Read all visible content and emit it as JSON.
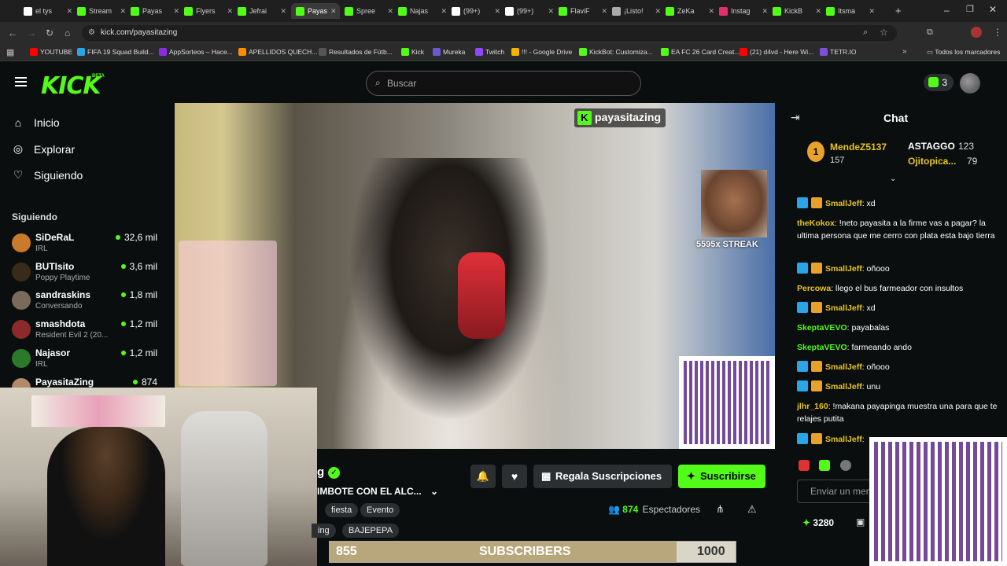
{
  "browser": {
    "tabs": [
      {
        "label": "el tys",
        "color": "#ffffff"
      },
      {
        "label": "Stream",
        "color": "#53fc18"
      },
      {
        "label": "Payas",
        "color": "#53fc18"
      },
      {
        "label": "Flyers",
        "color": "#53fc18"
      },
      {
        "label": "Jefrai",
        "color": "#53fc18"
      },
      {
        "label": "Payas",
        "color": "#53fc18"
      },
      {
        "label": "Spree",
        "color": "#53fc18"
      },
      {
        "label": "Najas",
        "color": "#53fc18"
      },
      {
        "label": "(99+)",
        "color": "#ffffff"
      },
      {
        "label": "(99+)",
        "color": "#ffffff"
      },
      {
        "label": "FlaviF",
        "color": "#53fc18"
      },
      {
        "label": "¡Listo!",
        "color": "#aaaaaa"
      },
      {
        "label": "ZeKa",
        "color": "#53fc18"
      },
      {
        "label": "Instag",
        "color": "#e1306c"
      },
      {
        "label": "KickB",
        "color": "#53fc18"
      },
      {
        "label": "Itsma",
        "color": "#53fc18"
      }
    ],
    "url": "kick.com/payasitazing",
    "bookmarks": [
      {
        "label": "YOUTUBE",
        "color": "#ff0000"
      },
      {
        "label": "FIFA 19 Squad Build...",
        "color": "#2aa6e8"
      },
      {
        "label": "AppSorteos – Hace...",
        "color": "#8a2be2"
      },
      {
        "label": "APELLIDOS QUECH...",
        "color": "#ff8c00"
      },
      {
        "label": "Resultados de Fútb...",
        "color": "#555555"
      },
      {
        "label": "Kick",
        "color": "#53fc18"
      },
      {
        "label": "Mureka",
        "color": "#6a5acd"
      },
      {
        "label": "Twitch",
        "color": "#9146ff"
      },
      {
        "label": "!!! - Google Drive",
        "color": "#f4b400"
      },
      {
        "label": "KickBot: Customiza...",
        "color": "#53fc18"
      },
      {
        "label": "EA FC 26 Card Creat...",
        "color": "#53fc18"
      },
      {
        "label": "(21) d4vd - Here Wi...",
        "color": "#ff0000"
      },
      {
        "label": "TETR.IO",
        "color": "#7b4fd6"
      }
    ],
    "all_bookmarks": "Todos los marcadores"
  },
  "kick": {
    "logo": "KICK",
    "beta": "BETA",
    "search_placeholder": "Buscar",
    "notif_count": "3"
  },
  "sidebar": {
    "nav": [
      {
        "label": "Inicio",
        "icon": "home-icon"
      },
      {
        "label": "Explorar",
        "icon": "compass-icon"
      },
      {
        "label": "Siguiendo",
        "icon": "heart-icon"
      }
    ],
    "following_title": "Siguiendo",
    "following": [
      {
        "name": "SiDeRaL",
        "category": "IRL",
        "viewers": "32,6 mil",
        "color": "#c97a2a"
      },
      {
        "name": "BUTIsito",
        "category": "Poppy Playtime",
        "viewers": "3,6 mil",
        "color": "#3a2a1a"
      },
      {
        "name": "sandraskins",
        "category": "Conversando",
        "viewers": "1,8 mil",
        "color": "#7a6a5a"
      },
      {
        "name": "smashdota",
        "category": "Resident Evil 2 (20...",
        "viewers": "1,2 mil",
        "color": "#8a2a2a"
      },
      {
        "name": "Najasor",
        "category": "IRL",
        "viewers": "1,2 mil",
        "color": "#2a7a2a"
      },
      {
        "name": "PayasitaZing",
        "category": "",
        "viewers": "874",
        "color": "#b08a6a"
      }
    ]
  },
  "video": {
    "watermark": "payasitazing",
    "streak": "5595x STREAK"
  },
  "stream_info": {
    "title": "IMBOTE CON EL ALC...",
    "tags": [
      "fiesta",
      "Evento",
      "BAJEPEPA"
    ],
    "tag_partial": "ing",
    "name_partial": "g",
    "viewers": "874",
    "viewers_label": "Espectadores",
    "gift_label": "Regala Suscripciones",
    "subscribe_label": "Suscribirse"
  },
  "sub_goal": {
    "current": "855",
    "label": "SUBSCRIBERS",
    "target": "1000",
    "progress": 0.855
  },
  "chat": {
    "title": "Chat",
    "top": [
      {
        "name": "MendeZ5137",
        "count": "157"
      },
      {
        "name": "ASTAGGO",
        "count": "123"
      },
      {
        "name": "Ojitopica...",
        "count": "79"
      }
    ],
    "messages": [
      {
        "user": "SmallJeff",
        "badges": true,
        "text": "xd",
        "color": "#e8c51c"
      },
      {
        "user": "theKokox",
        "badges": false,
        "text": "!neto payasita a la firme vas a pagar? la ultima persona que me cerro con plata esta bajo tierra",
        "color": "#e8c51c"
      },
      {
        "user": "SmallJeff",
        "badges": true,
        "text": "oñooo",
        "color": "#e8c51c"
      },
      {
        "user": "Percowa",
        "badges": false,
        "text": "llego el bus farmeador con insultos",
        "color": "#e8c51c"
      },
      {
        "user": "SmallJeff",
        "badges": true,
        "text": "xd",
        "color": "#e8c51c"
      },
      {
        "user": "SkeptaVEVO",
        "badges": false,
        "text": "payabalas",
        "color": "#53fc18"
      },
      {
        "user": "SkeptaVEVO",
        "badges": false,
        "text": "farmeando ando",
        "color": "#53fc18"
      },
      {
        "user": "SmallJeff",
        "badges": true,
        "text": "oñooo",
        "color": "#e8c51c"
      },
      {
        "user": "SmallJeff",
        "badges": true,
        "text": "unu",
        "color": "#e8c51c"
      },
      {
        "user": "jlhr_160",
        "badges": false,
        "text": "!makana payapinga muestra una para que te relajes putita",
        "color": "#e8c51c"
      },
      {
        "user": "SmallJeff",
        "badges": true,
        "text": "",
        "color": "#e8c51c"
      }
    ],
    "input_placeholder": "Enviar un mensaje",
    "points": "3280"
  }
}
